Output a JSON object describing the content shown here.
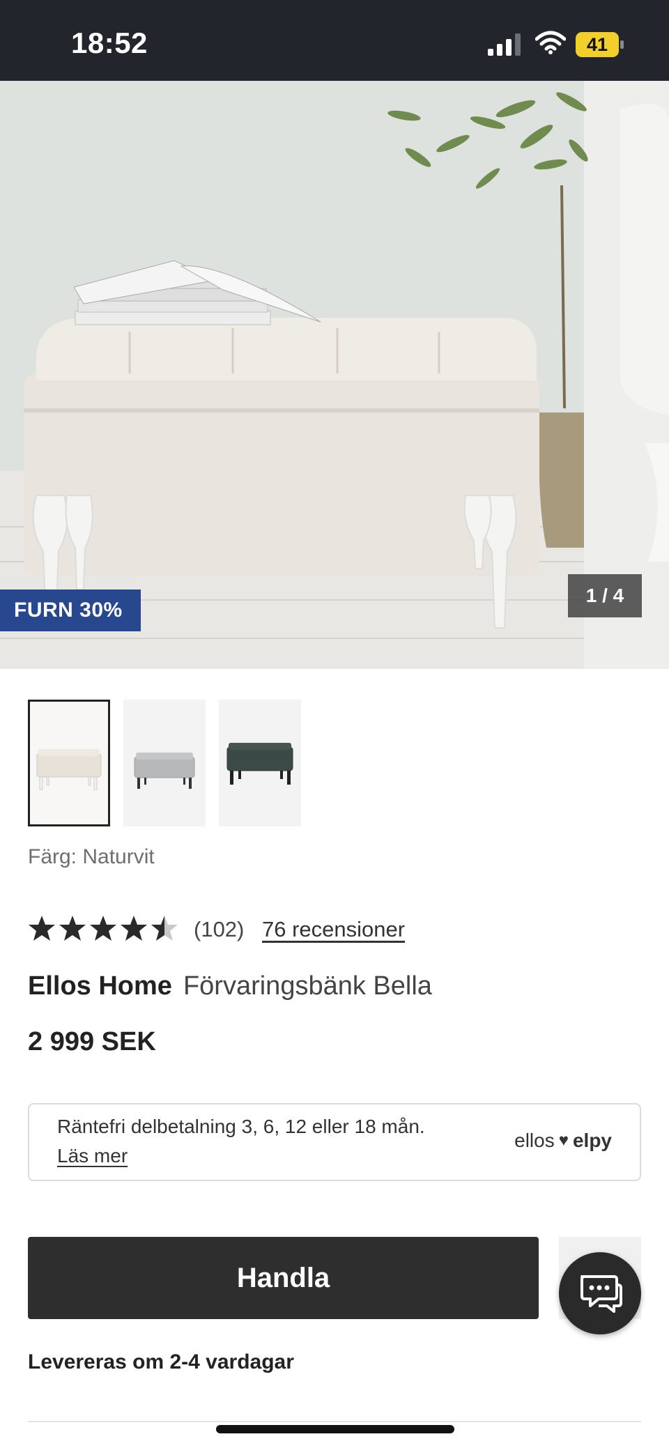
{
  "status_bar": {
    "time": "18:52",
    "battery_level": "41"
  },
  "gallery": {
    "promo_badge": "FURN 30%",
    "image_counter": "1 / 4"
  },
  "thumbnails": [
    {
      "color": "#e7e1d8",
      "leg": "#f2f2f2",
      "selected": true
    },
    {
      "color": "#b6b8ba",
      "leg": "#333333",
      "selected": false
    },
    {
      "color": "#3c4a47",
      "leg": "#222222",
      "selected": false
    }
  ],
  "product": {
    "color_label": "Färg: Naturvit",
    "rating": 4.5,
    "rating_count": "(102)",
    "reviews_link": "76 recensioner",
    "brand": "Ellos Home",
    "name": "Förvaringsbänk Bella",
    "price": "2 999 SEK"
  },
  "payment": {
    "text": "Räntefri delbetalning 3, 6, 12 eller 18 mån.",
    "read_more": "Läs mer",
    "brand_left": "ellos",
    "brand_right": "elpy"
  },
  "actions": {
    "buy_label": "Handla",
    "delivery": "Levereras om 2-4 vardagar"
  },
  "colors": {
    "accent_badge": "#27478f",
    "button_dark": "#2e2e2e"
  }
}
